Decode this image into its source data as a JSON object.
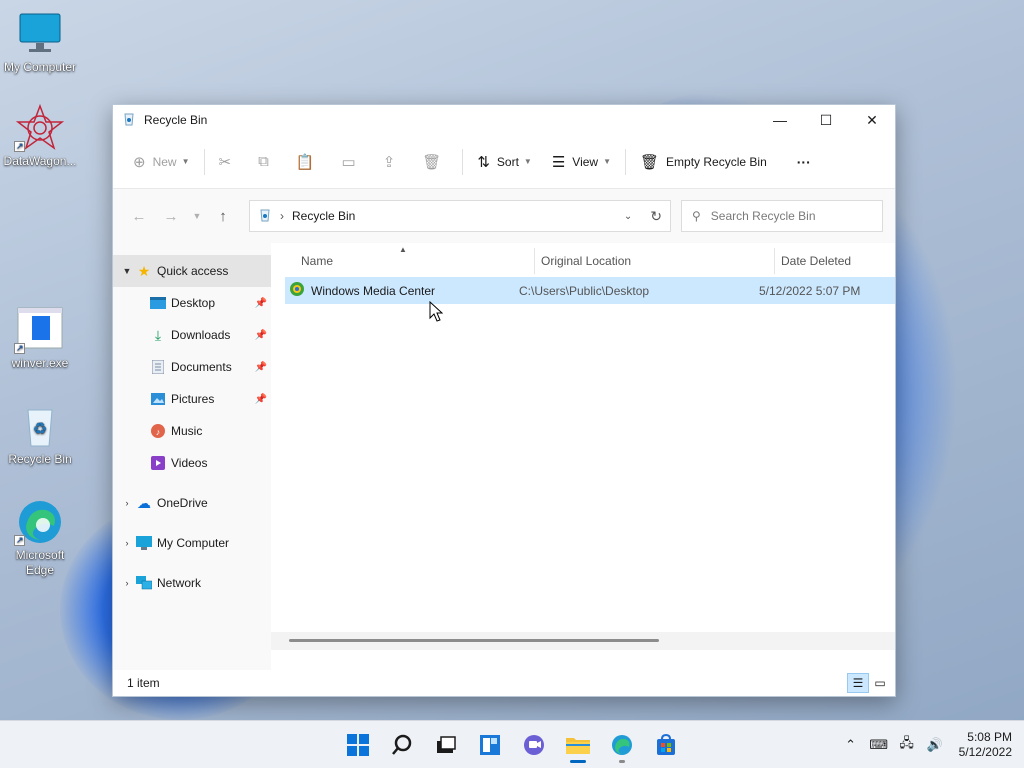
{
  "desktop": {
    "icons": [
      {
        "label": "My Computer",
        "icon": "monitor-icon"
      },
      {
        "label": "DataWagon...",
        "icon": "datawagon-icon"
      },
      {
        "label": "winver.exe",
        "icon": "winver-icon"
      },
      {
        "label": "Recycle Bin",
        "icon": "recycle-bin-icon"
      },
      {
        "label": "Microsoft Edge",
        "icon": "edge-icon"
      }
    ]
  },
  "window": {
    "title": "Recycle Bin",
    "controls": {
      "minimize": "—",
      "maximize": "☐",
      "close": "✕"
    },
    "commandbar": {
      "new_label": "New",
      "sort_label": "Sort",
      "view_label": "View",
      "empty_label": "Empty Recycle Bin",
      "more_label": "···"
    },
    "address": {
      "path": "Recycle Bin",
      "search_placeholder": "Search Recycle Bin"
    },
    "sidebar": {
      "items": [
        {
          "label": "Quick access",
          "icon": "star-icon"
        },
        {
          "label": "Desktop",
          "icon": "desktop-folder-icon",
          "pinned": true
        },
        {
          "label": "Downloads",
          "icon": "downloads-icon",
          "pinned": true
        },
        {
          "label": "Documents",
          "icon": "documents-icon",
          "pinned": true
        },
        {
          "label": "Pictures",
          "icon": "pictures-icon",
          "pinned": true
        },
        {
          "label": "Music",
          "icon": "music-icon"
        },
        {
          "label": "Videos",
          "icon": "videos-icon"
        },
        {
          "label": "OneDrive",
          "icon": "onedrive-icon"
        },
        {
          "label": "My Computer",
          "icon": "computer-icon"
        },
        {
          "label": "Network",
          "icon": "network-icon"
        }
      ]
    },
    "columns": [
      "Name",
      "Original Location",
      "Date Deleted"
    ],
    "files": [
      {
        "name": "Windows Media Center",
        "location": "C:\\Users\\Public\\Desktop",
        "deleted": "5/12/2022 5:07 PM"
      }
    ],
    "status": "1 item"
  },
  "taskbar": {
    "time": "5:08 PM",
    "date": "5/12/2022"
  },
  "colors": {
    "accent": "#0067c0",
    "selection": "#cce8ff",
    "sidebar_selected": "#e4e4e4"
  }
}
